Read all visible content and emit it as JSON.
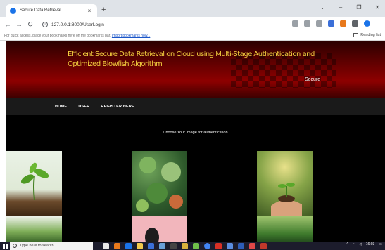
{
  "browser": {
    "tab_title": "Secure Data Retrieval",
    "tab_close": "×",
    "new_tab": "+",
    "window_controls": {
      "collapse": "⌄",
      "minimize": "–",
      "maximize": "❐",
      "close": "✕"
    },
    "url": "127.0.0.1:8000/UserLogin",
    "bookmarks_message": "For quick access, place your bookmarks here on the bookmarks bar.",
    "bookmarks_link": "Import bookmarks now...",
    "reading_list": "Reading list"
  },
  "page": {
    "title": "Efficient Secure Data Retrieval on Cloud using Multi-Stage Authentication and Optimized Blowfish Algorithm",
    "tagline": "Secure",
    "nav": [
      {
        "label": "HOME"
      },
      {
        "label": "USER"
      },
      {
        "label": "REGISTER HERE"
      }
    ],
    "prompt": "Choose Your Image for authentication",
    "images": [
      {
        "name": "plant-sprout-image"
      },
      {
        "name": "succulents-image"
      },
      {
        "name": "hands-plant-image"
      },
      {
        "name": "plant-row-image"
      },
      {
        "name": "pink-background-image"
      },
      {
        "name": "trees-image"
      }
    ]
  },
  "taskbar": {
    "search_placeholder": "Type here to search",
    "time": "16:03",
    "colors": {
      "taskbar_bg": "#1c1c2c"
    }
  },
  "colors": {
    "title_yellow": "#f4d03f",
    "banner_red": "#8e0000",
    "page_bg": "#000000",
    "nav_bg": "#1a1a1a",
    "chrome_accent": "#1a73e8"
  }
}
